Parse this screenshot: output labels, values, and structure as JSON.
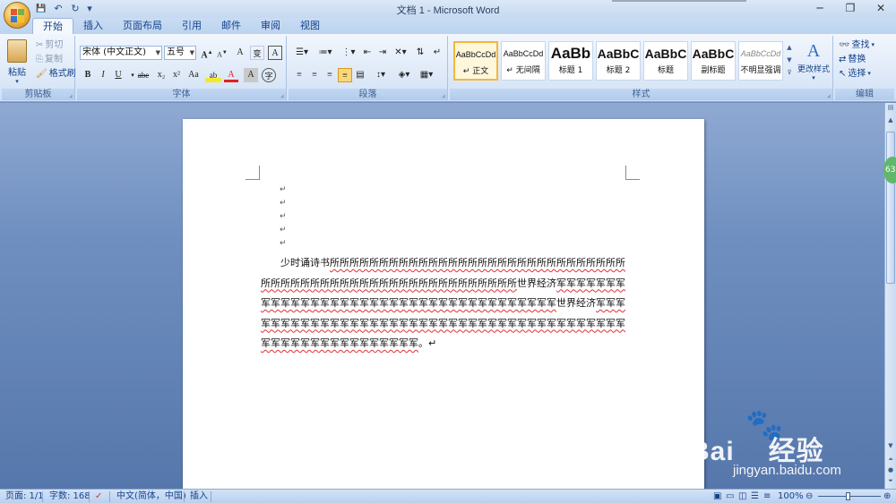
{
  "window": {
    "title": "文档 1 - Microsoft Word",
    "minimize": "─",
    "restore": "❐",
    "close": "✕"
  },
  "qat": {
    "save": "💾",
    "undo": "↶",
    "redo": "↻",
    "more": "▾"
  },
  "tabs": [
    "开始",
    "插入",
    "页面布局",
    "引用",
    "邮件",
    "审阅",
    "视图"
  ],
  "clipboard": {
    "paste": "粘贴",
    "cut": "剪切",
    "copy": "复制",
    "format_painter": "格式刷",
    "label": "剪贴板"
  },
  "font": {
    "name": "宋体 (中文正文)",
    "size": "五号",
    "label": "字体",
    "bold": "B",
    "italic": "I",
    "underline": "U",
    "strike": "abe",
    "sub": "x₂",
    "sup": "x²",
    "case": "Aa",
    "grow": "A",
    "shrink": "A",
    "clear": "A",
    "pinyin": "变",
    "border": "A",
    "highlight": "ab",
    "color": "A",
    "shade": "A",
    "circle": "字"
  },
  "paragraph": {
    "label": "段落"
  },
  "styles": {
    "label": "样式",
    "change": "更改样式",
    "items": [
      {
        "preview": "AaBbCcDd",
        "name": "↵ 正文"
      },
      {
        "preview": "AaBbCcDd",
        "name": "↵ 无间隔"
      },
      {
        "preview": "AaBb",
        "name": "标题 1"
      },
      {
        "preview": "AaBbC",
        "name": "标题 2"
      },
      {
        "preview": "AaBbC",
        "name": "标题"
      },
      {
        "preview": "AaBbC",
        "name": "副标题"
      },
      {
        "preview": "AaBbCcDd",
        "name": "不明显强调"
      }
    ]
  },
  "editing": {
    "label": "编辑",
    "find": "查找",
    "replace": "替换",
    "select": "选择"
  },
  "document": {
    "para_mark": "↵",
    "text_normal_1": "少时诵诗书",
    "text_squig_1": "所所所所所所所所所所所所所所所所所所所所所所所所所所所所所所所所所所所所所所所所所所所所所所所所所所所所所所所所",
    "text_normal_2": "世界经济",
    "text_squig_2": "军军军军军军军军军军军军军军军军军军军军军军军军军军军军军军军军军军军军军",
    "text_normal_3": "世界经济",
    "text_squig_3": "军军军军军军军军军军军军军军军军军军军军军军军军军军军军军军军军军军军军军军军军军军军军军军军军军军军军军军军军",
    "text_end": "。↵"
  },
  "status": {
    "page": "页面: 1/1",
    "words": "字数: 168",
    "lang": "中文(简体，中国)",
    "mode": "插入",
    "zoom": "100%"
  },
  "watermark": {
    "brand": "Bai",
    "brand2": "经验",
    "url": "jingyan.baidu.com"
  },
  "green_tab": "63"
}
